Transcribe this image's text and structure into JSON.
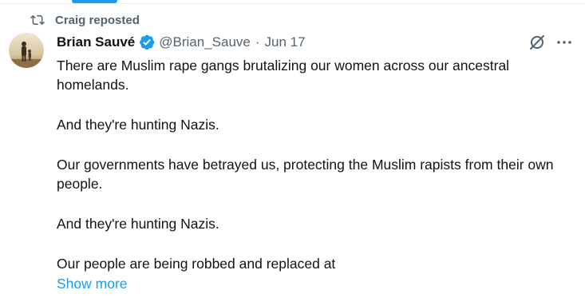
{
  "colors": {
    "accent": "#1d9bf0",
    "text": "#0f1419",
    "muted": "#536471"
  },
  "repost": {
    "icon": "repost-icon",
    "text": "Craig reposted"
  },
  "author": {
    "name": "Brian Sauvé",
    "handle": "@Brian_Sauve",
    "separator": "·",
    "date": "Jun 17",
    "verified_icon": "verified-badge-icon"
  },
  "actions": {
    "grok_icon": "grok-icon",
    "more_icon": "more-options-icon"
  },
  "post": {
    "paragraphs": [
      "There are Muslim rape gangs brutalizing our women across our ancestral homelands.",
      "And they're hunting Nazis.",
      "Our governments have betrayed us, protecting the Muslim rapists from their own people.",
      "And they're hunting Nazis.",
      "Our people are being robbed and replaced at"
    ],
    "show_more": "Show more"
  }
}
